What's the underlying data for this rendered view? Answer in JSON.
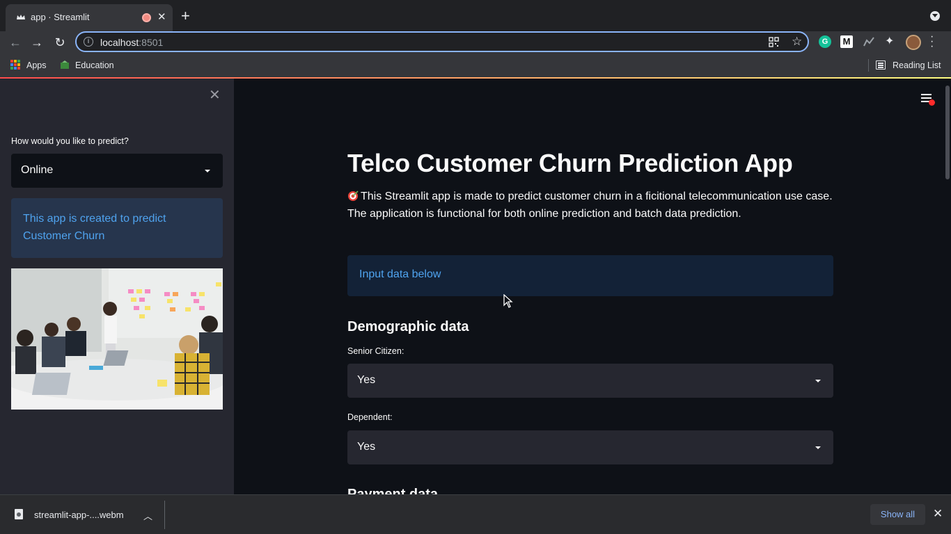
{
  "browser": {
    "tab_title": "app · Streamlit",
    "tab_close": "✕",
    "new_tab": "+",
    "url_host": "localhost",
    "url_port": ":8501",
    "bookmarks": [
      {
        "label": "Apps"
      },
      {
        "label": "Education"
      }
    ],
    "reading_list": "Reading List"
  },
  "sidebar": {
    "close": "✕",
    "predict_label": "How would you like to predict?",
    "predict_value": "Online",
    "info_text": "This app is created to predict Customer Churn"
  },
  "main": {
    "title": "Telco Customer Churn Prediction App",
    "description": "This Streamlit app is made to predict customer churn in a ficitional telecommunication use case. The application is functional for both online prediction and batch data prediction.",
    "info_text": "Input data below",
    "section_demographic": "Demographic data",
    "senior_label": "Senior Citizen:",
    "senior_value": "Yes",
    "dependent_label": "Dependent:",
    "dependent_value": "Yes",
    "section_payment": "Payment data"
  },
  "download_bar": {
    "file_name": "streamlit-app-....webm",
    "show_all": "Show all",
    "close": "✕"
  },
  "colors": {
    "streamlit_bg": "#0e1117",
    "sidebar_bg": "#262730",
    "info_blue": "#4fa3ef",
    "accent_red": "#ff4b4b"
  }
}
